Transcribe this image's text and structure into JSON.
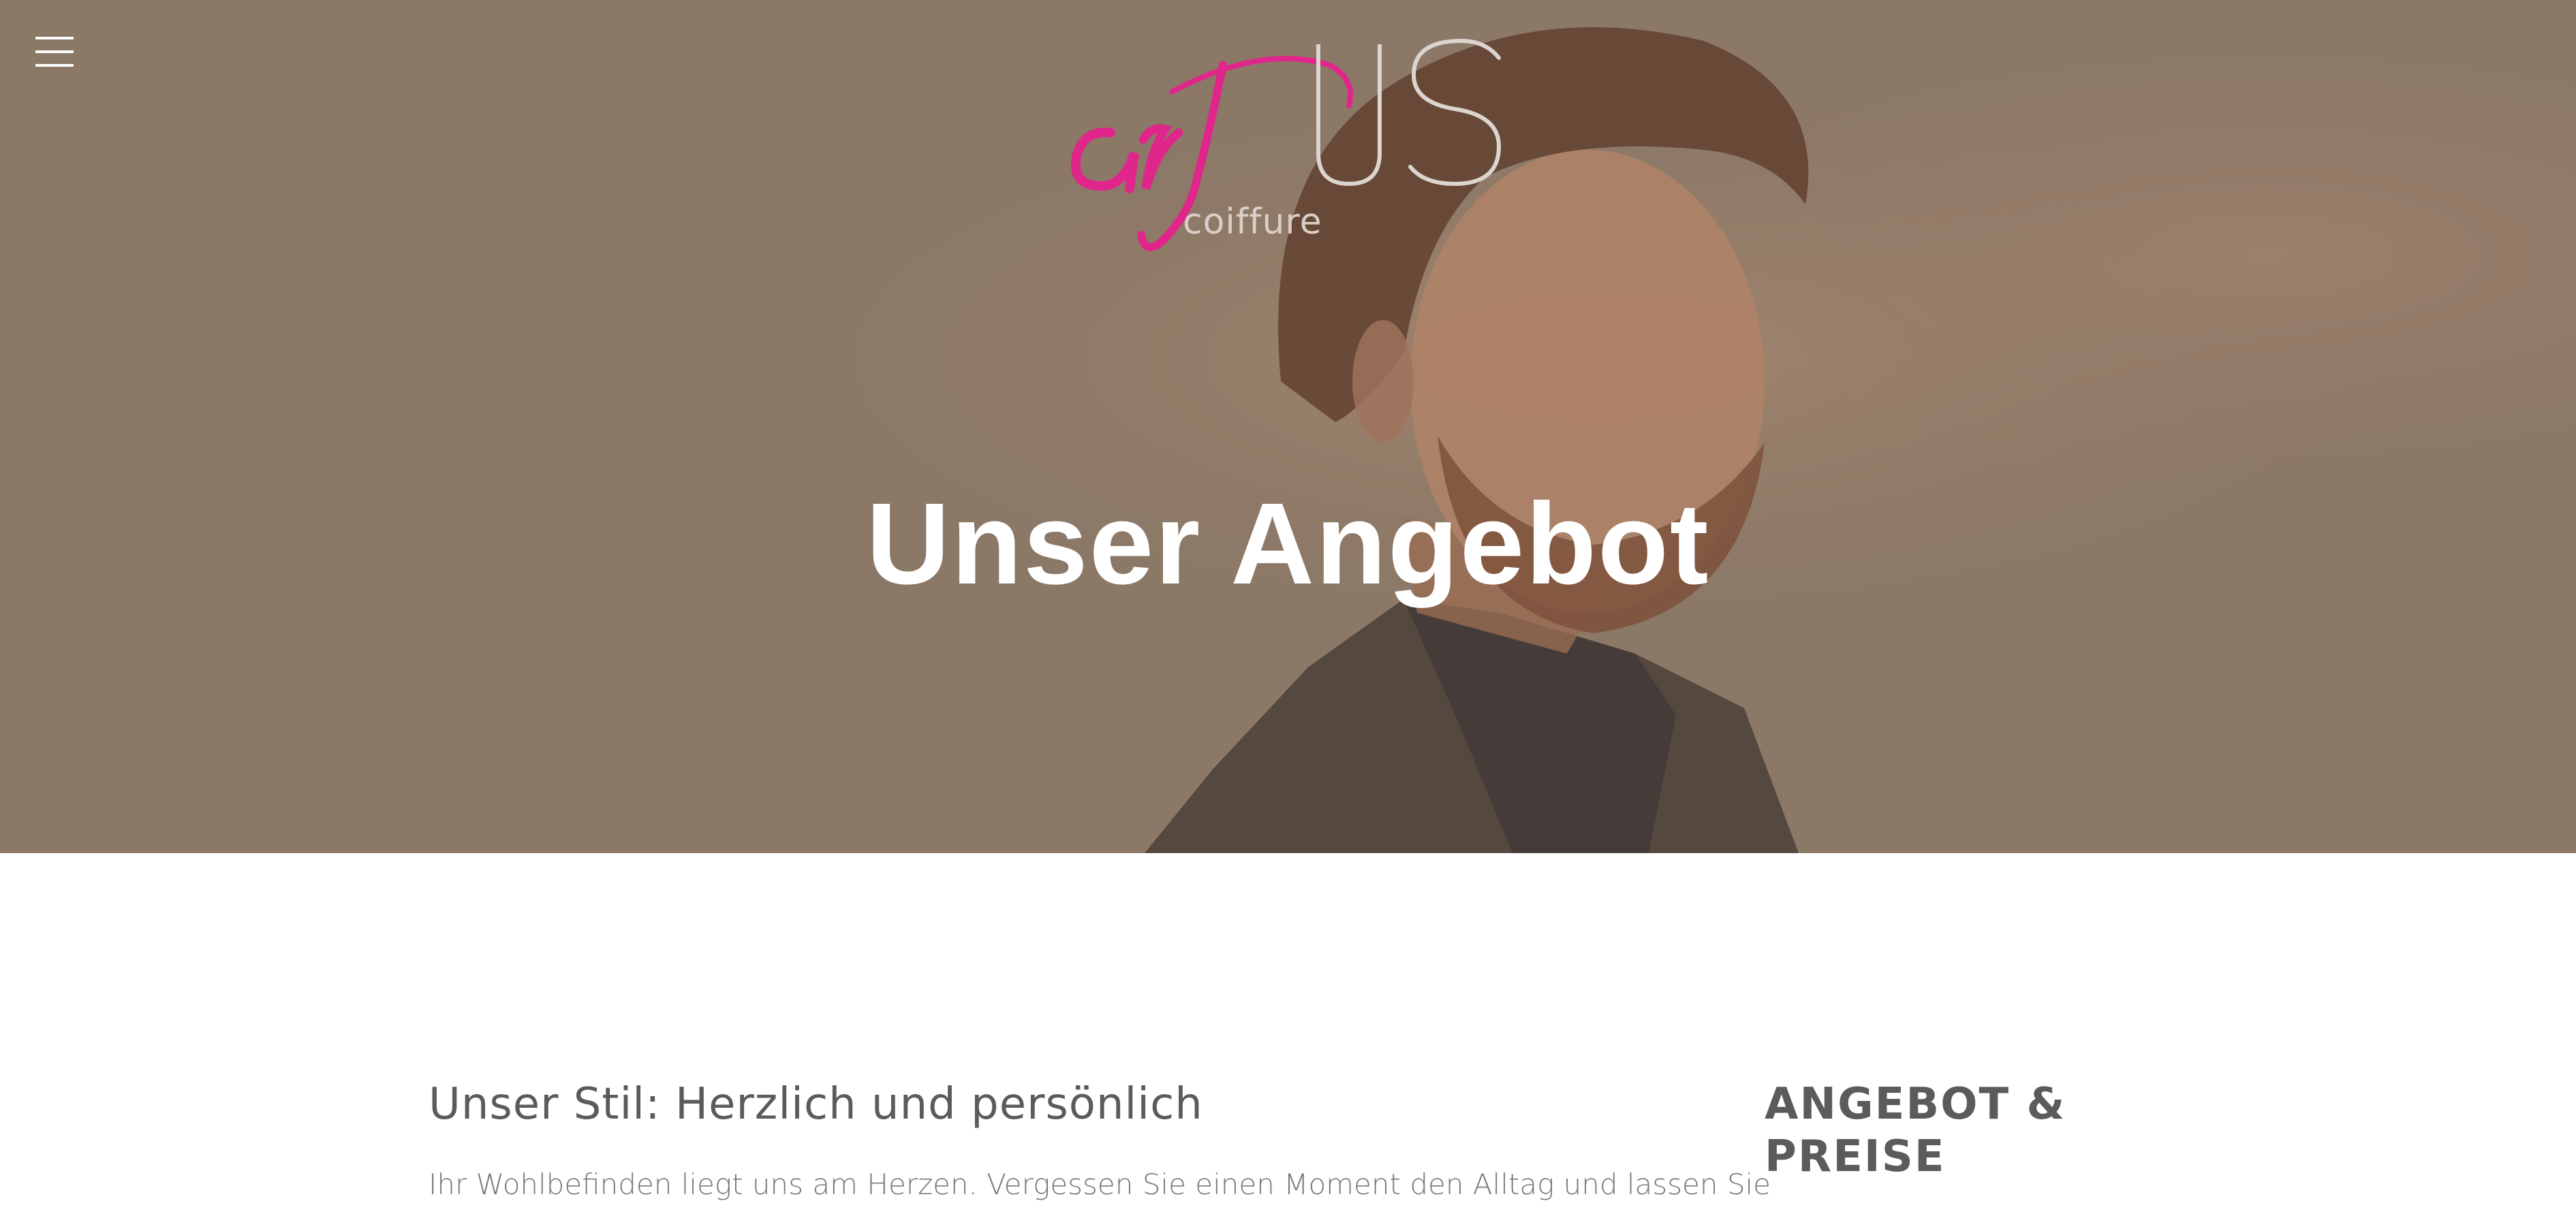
{
  "menu": {
    "icon": "hamburger-menu-icon"
  },
  "logo": {
    "script_text": "art",
    "letters": "US",
    "subtitle": "coiffure"
  },
  "colors": {
    "brand_pink": "#e0268a",
    "hero_tone": "#8d7a69",
    "heading_text": "#5d5b5a",
    "body_text": "#7a7877"
  },
  "hero": {
    "title": "Unser Angebot"
  },
  "main": {
    "heading": "Unser Stil: Herzlich und persönlich",
    "paragraph": "Ihr Wohlbefinden liegt uns am Herzen. Vergessen Sie einen Moment den Alltag und lassen Sie"
  },
  "sidebar": {
    "heading": "ANGEBOT & PREISE"
  }
}
